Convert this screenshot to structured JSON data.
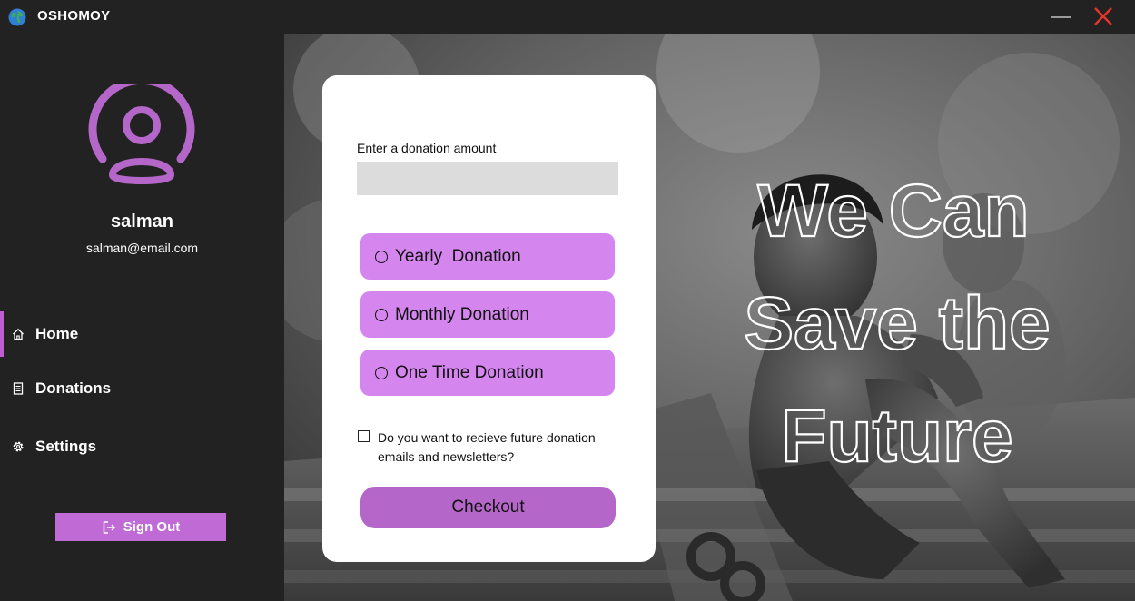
{
  "app": {
    "title": "OSHOMOY"
  },
  "window": {
    "minimize_icon": "minimize-icon",
    "close_icon": "close-icon"
  },
  "colors": {
    "accent": "#c06ad6",
    "option_bg": "#d586ee",
    "checkout_bg": "#b566c9",
    "sidebar_bg": "#222222",
    "close_red": "#e8352a"
  },
  "user": {
    "name": "salman",
    "email": "salman@email.com"
  },
  "sidebar": {
    "items": [
      {
        "label": "Home",
        "icon": "home-icon",
        "active": true
      },
      {
        "label": "Donations",
        "icon": "receipt-icon",
        "active": false
      },
      {
        "label": "Settings",
        "icon": "gear-icon",
        "active": false
      }
    ],
    "signout": {
      "label": "Sign Out",
      "icon": "sign-out-icon"
    }
  },
  "form": {
    "amount_label": "Enter a donation amount",
    "amount_value": "",
    "options": [
      {
        "label": "Yearly  Donation",
        "selected": false
      },
      {
        "label": "Monthly Donation",
        "selected": false
      },
      {
        "label": "One Time Donation",
        "selected": false
      }
    ],
    "newsletter": {
      "label": "Do you want to recieve future donation emails and newsletters?",
      "checked": false
    },
    "checkout_label": "Checkout"
  },
  "hero": {
    "slogan_lines": [
      "We Can",
      "Save the",
      "Future"
    ]
  }
}
